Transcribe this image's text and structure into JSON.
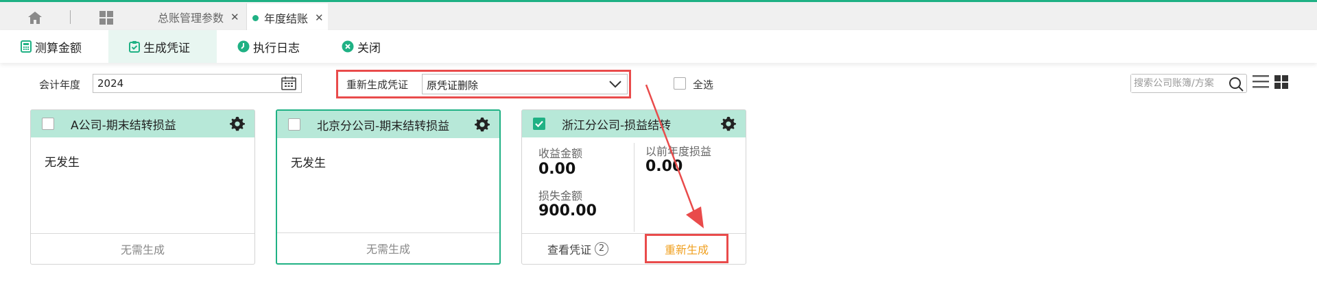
{
  "tabs": {
    "home_icon": "home-icon",
    "apps_icon": "grid-icon",
    "items": [
      {
        "label": "总账管理参数",
        "active": false
      },
      {
        "label": "年度结账",
        "active": true
      }
    ]
  },
  "toolbar": {
    "calc_label": "测算金额",
    "generate_label": "生成凭证",
    "log_label": "执行日志",
    "close_label": "关闭"
  },
  "filters": {
    "year_label": "会计年度",
    "year_value": "2024",
    "regen_label": "重新生成凭证",
    "regen_value": "原凭证删除",
    "select_all_label": "全选",
    "search_placeholder": "搜索公司账簿/方案"
  },
  "cards": [
    {
      "title": "A公司-期末结转损益",
      "checked": false,
      "body": "无发生",
      "footer": "无需生成"
    },
    {
      "title": "北京分公司-期末结转损益",
      "checked": false,
      "body": "无发生",
      "footer": "无需生成"
    },
    {
      "title": "浙江分公司-损益结转",
      "checked": true,
      "income_label": "收益金额",
      "income_value": "0.00",
      "loss_label": "损失金额",
      "loss_value": "900.00",
      "prior_label": "以前年度损益",
      "prior_value": "0.00",
      "view_label": "查看凭证",
      "view_count": "2",
      "regen_button": "重新生成"
    }
  ],
  "colors": {
    "accent": "#1fb184",
    "card_header": "#b7e8d8",
    "highlight_red": "#e94b4b",
    "regen_text": "#f0a020"
  }
}
